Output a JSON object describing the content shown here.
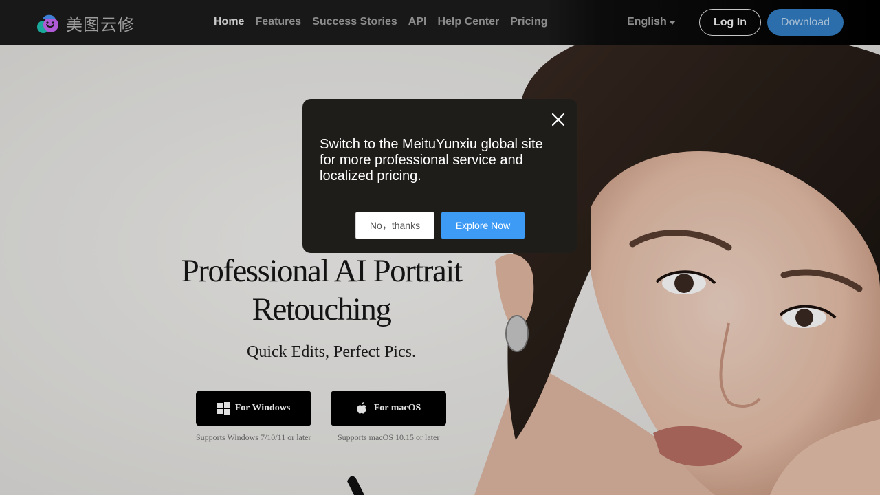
{
  "header": {
    "logo_text": "美图云修",
    "nav": [
      {
        "label": "Home"
      },
      {
        "label": "Features"
      },
      {
        "label": "Success Stories"
      },
      {
        "label": "API"
      },
      {
        "label": "Help Center"
      },
      {
        "label": "Pricing"
      }
    ],
    "language": "English",
    "login_label": "Log In",
    "download_label": "Download"
  },
  "hero": {
    "title_line1": "Professional AI Portrait",
    "title_line2": "Retouching",
    "subtitle": "Quick Edits, Perfect Pics.",
    "windows_button": "For Windows",
    "windows_note": "Supports Windows 7/10/11 or later",
    "mac_button": "For macOS",
    "mac_note": "Supports macOS 10.15 or later"
  },
  "modal": {
    "message": "Switch to the MeituYunxiu global site for more professional service and localized pricing.",
    "decline_label": "No，thanks",
    "confirm_label": "Explore Now"
  },
  "colors": {
    "nav_bg": "#181818",
    "modal_bg": "#1f1d1a",
    "accent_blue": "#3d9af5",
    "download_blue": "#2c6eab"
  },
  "icons": {
    "close": "close-icon",
    "windows": "windows-icon",
    "apple": "apple-icon",
    "language_caret": "chevron-down-icon"
  }
}
